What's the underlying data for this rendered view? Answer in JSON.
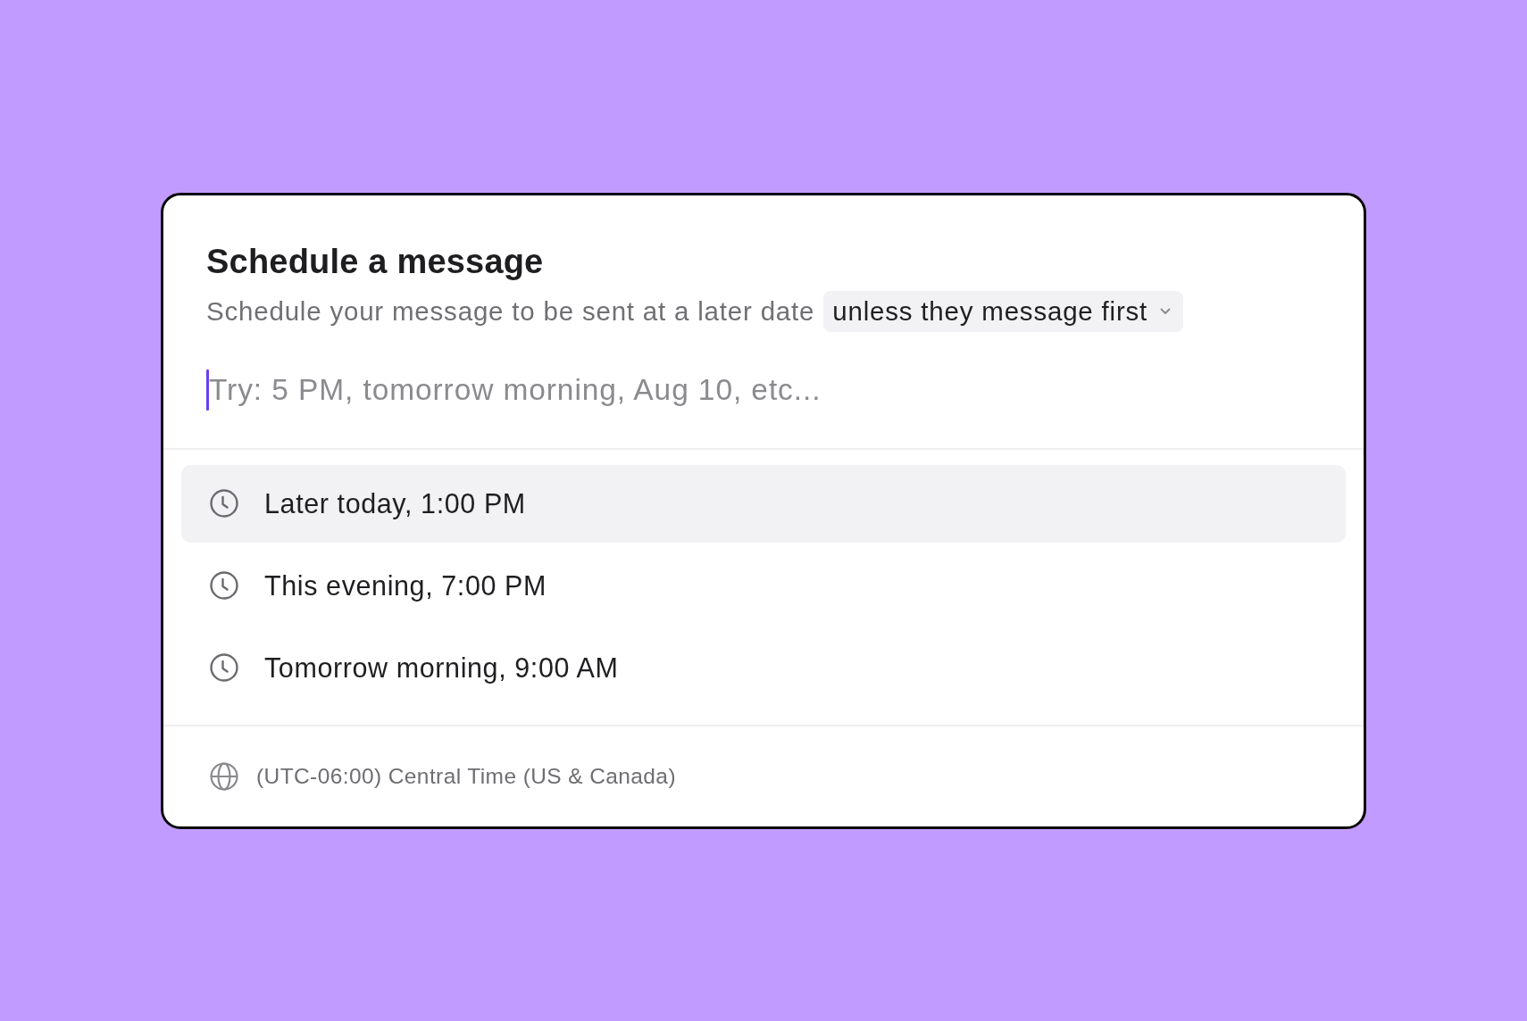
{
  "dialog": {
    "title": "Schedule a message",
    "subtitle": "Schedule your message to be sent at a later date",
    "condition_dropdown": {
      "value": "unless they message first"
    },
    "time_input": {
      "placeholder": "Try: 5 PM, tomorrow morning, Aug 10, etc...",
      "focused": true
    },
    "suggestions": [
      {
        "label": "Later today, 1:00 PM",
        "selected": true
      },
      {
        "label": "This evening, 7:00 PM",
        "selected": false
      },
      {
        "label": "Tomorrow morning, 9:00 AM",
        "selected": false
      }
    ],
    "timezone": "(UTC-06:00) Central Time (US & Canada)"
  }
}
